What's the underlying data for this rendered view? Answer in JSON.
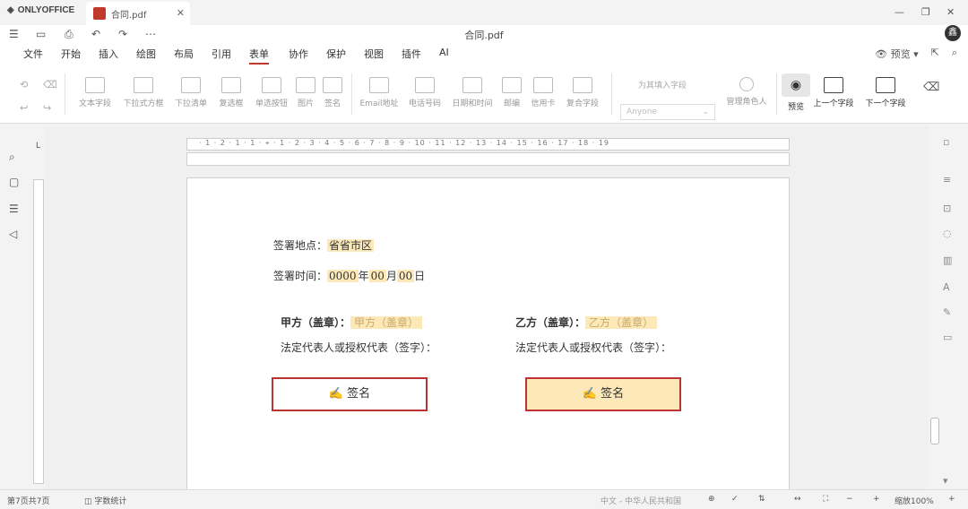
{
  "window": {
    "brand": "ONLYOFFICE",
    "tab_label": "合同.pdf",
    "doc_title": "合同.pdf",
    "avatar_letter": "鑫"
  },
  "menu": {
    "tabs": [
      "文件",
      "开始",
      "插入",
      "绘图",
      "布局",
      "引用",
      "表单",
      "协作",
      "保护",
      "视图",
      "插件",
      "AI"
    ],
    "active_tab": "表单",
    "view_label": "预览"
  },
  "toolbar": {
    "fields": [
      {
        "label": "文本字段",
        "icon": "text-field-icon"
      },
      {
        "label": "下拉式方框",
        "icon": "combo-box-icon"
      },
      {
        "label": "下拉清单",
        "icon": "dropdown-icon"
      },
      {
        "label": "复选框",
        "icon": "checkbox-icon"
      },
      {
        "label": "单选按钮",
        "icon": "radio-button-icon"
      },
      {
        "label": "图片",
        "icon": "image-icon"
      },
      {
        "label": "签名",
        "icon": "signature-icon"
      },
      {
        "label": "Email地址",
        "icon": "email-icon"
      },
      {
        "label": "电话号码",
        "icon": "phone-icon"
      },
      {
        "label": "日期和时间",
        "icon": "date-time-icon"
      },
      {
        "label": "邮编",
        "icon": "zip-code-icon"
      },
      {
        "label": "信用卡",
        "icon": "credit-card-icon"
      },
      {
        "label": "复合字段",
        "icon": "complex-field-icon"
      }
    ],
    "role_label": "为其填入字段",
    "role_value": "Anyone",
    "manage_roles": "管理角色人",
    "view_form": "预览",
    "prev_field": "上一个字段",
    "next_field": "下一个字段"
  },
  "document": {
    "place_label": "签署地点：",
    "place_value": "省省市区",
    "time_label": "签署时间：",
    "year": "0000",
    "year_unit": "年",
    "month": "00",
    "month_unit": "月",
    "day": "00",
    "day_unit": "日",
    "party_a_label": "甲方（盖章）：",
    "party_a_value": "甲方（盖章）",
    "party_a_rep": "法定代表人或授权代表（签字）：",
    "party_b_label": "乙方（盖章）：",
    "party_b_value": "乙方（盖章）",
    "party_b_rep": "法定代表人或授权代表（签字）：",
    "sign_label": "签名"
  },
  "status": {
    "page_info": "第7页共7页",
    "word_count": "字数统计",
    "language": "中文 - 中华人民共和国",
    "zoom": "缩放100%"
  }
}
